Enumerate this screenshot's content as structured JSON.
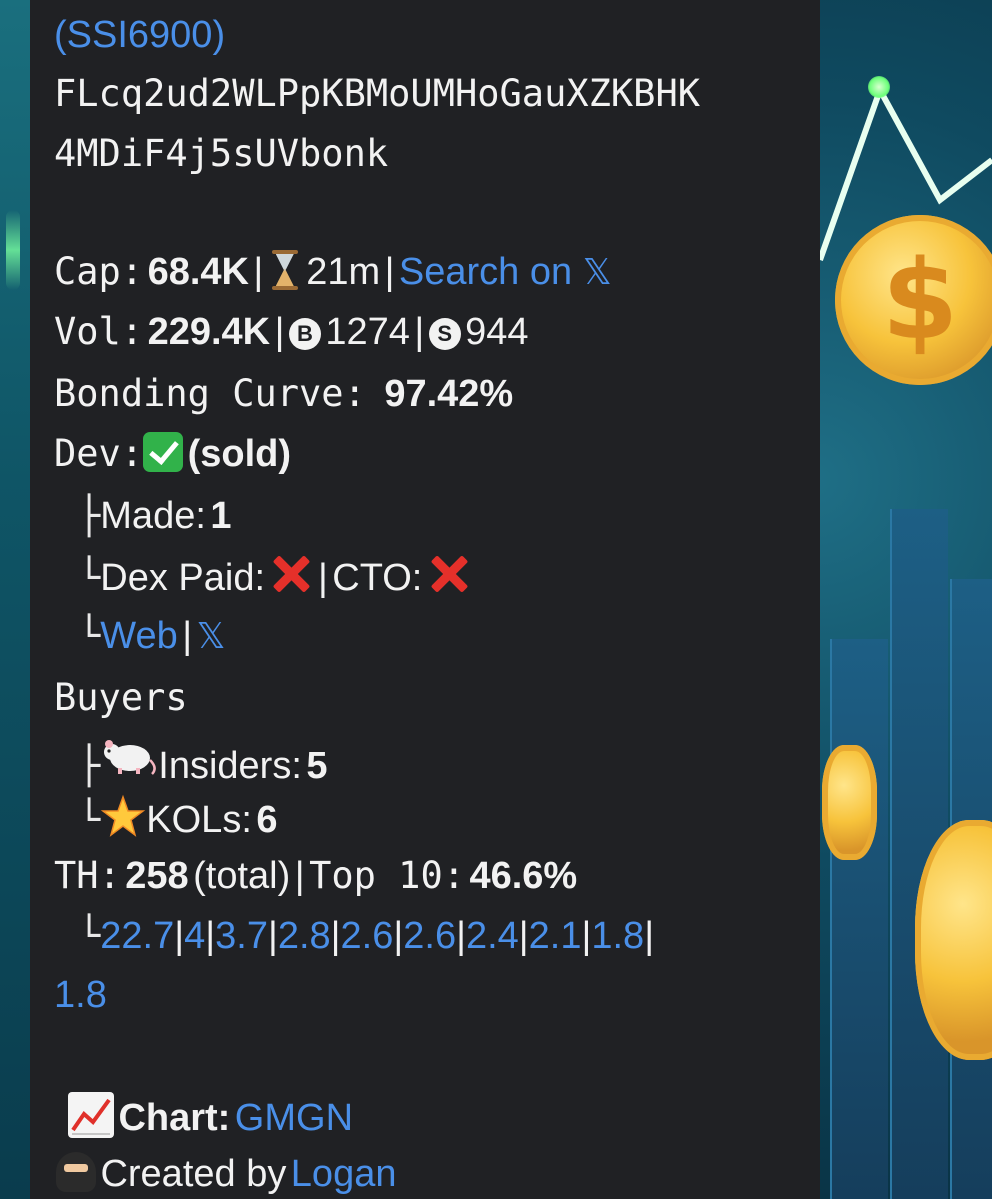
{
  "header": {
    "ticker_partial": "(SSI6900)",
    "address_line1": "FLcq2ud2WLPpKBMoUMHoGauXZKBHK",
    "address_line2": "4MDiF4j5sUVbonk"
  },
  "cap": {
    "label": "Cap:",
    "value": "68.4K",
    "age": "21m",
    "search_label": "Search on",
    "x_glyph": "𝕏"
  },
  "vol": {
    "label": "Vol:",
    "value": "229.4K",
    "buys": "1274",
    "sells": "944",
    "buy_badge": "B",
    "sell_badge": "S"
  },
  "bonding": {
    "label": "Bonding Curve:",
    "value": "97.42%"
  },
  "dev": {
    "label": "Dev:",
    "status": "(sold)",
    "made_label": "Made:",
    "made_value": "1",
    "dex_paid_label": "Dex Paid:",
    "cto_label": "CTO:",
    "web_label": "Web",
    "x_glyph": "𝕏"
  },
  "buyers": {
    "label": "Buyers",
    "insiders_label": "Insiders:",
    "insiders_value": "5",
    "kols_label": "KOLs:",
    "kols_value": "6"
  },
  "holders": {
    "th_label": "TH:",
    "th_value": "258",
    "th_suffix": "(total)",
    "top10_label": "Top 10:",
    "top10_value": "46.6%",
    "distribution": [
      "22.7",
      "4",
      "3.7",
      "2.8",
      "2.6",
      "2.6",
      "2.4",
      "2.1",
      "1.8",
      "1.8"
    ]
  },
  "footer": {
    "chart_label": "Chart:",
    "chart_link": "GMGN",
    "created_label": "Created by",
    "created_link": "Logan"
  },
  "tree_chars": {
    "branch": "├",
    "end": "└"
  },
  "separators": {
    "pipe": "|"
  },
  "colors": {
    "bubble": "#202124",
    "link": "#4a8fe8",
    "text": "#f2f2f2",
    "cross": "#e5302a",
    "check": "#31b24a"
  }
}
